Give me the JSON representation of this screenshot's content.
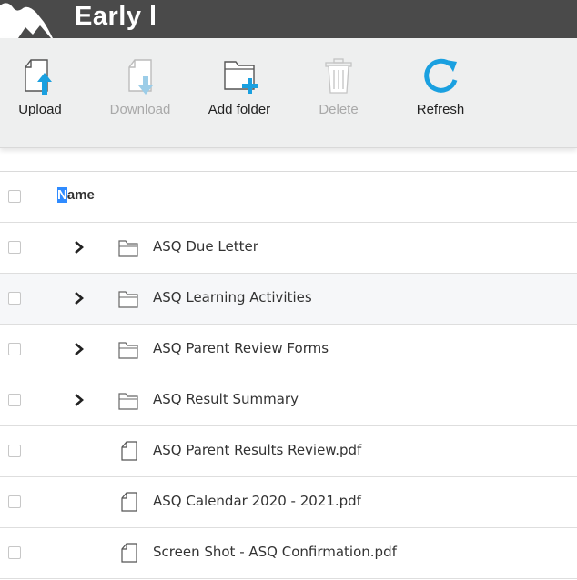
{
  "header": {
    "title": "Early l"
  },
  "toolbar": {
    "upload_label": "Upload",
    "download_label": "Download",
    "add_folder_label": "Add folder",
    "delete_label": "Delete",
    "refresh_label": "Refresh"
  },
  "table": {
    "column_name_first": "N",
    "column_name_rest": "ame",
    "rows": [
      {
        "name": "ASQ Due Letter",
        "type": "folder"
      },
      {
        "name": "ASQ Learning Activities",
        "type": "folder"
      },
      {
        "name": "ASQ Parent Review Forms",
        "type": "folder"
      },
      {
        "name": "ASQ Result Summary",
        "type": "folder"
      },
      {
        "name": "ASQ Parent Results Review.pdf",
        "type": "file"
      },
      {
        "name": "ASQ Calendar 2020 - 2021.pdf",
        "type": "file"
      },
      {
        "name": "Screen Shot - ASQ Confirmation.pdf",
        "type": "file"
      }
    ]
  },
  "colors": {
    "header_bg": "#4a4a4a",
    "toolbar_bg": "#eeefef",
    "accent_blue": "#1aa0e0",
    "selection_blue": "#2f8bff",
    "disabled_text": "#a9a9a9"
  }
}
